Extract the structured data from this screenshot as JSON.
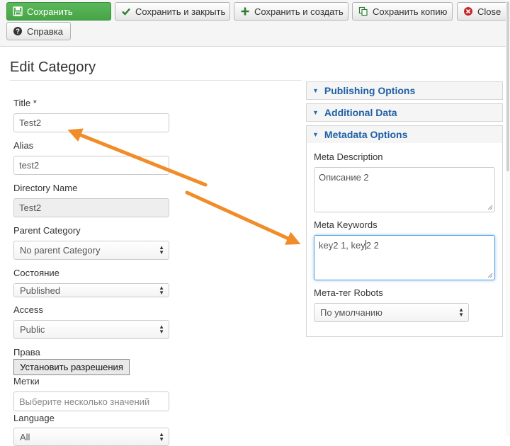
{
  "toolbar": {
    "save": "Сохранить",
    "save_close": "Сохранить и закрыть",
    "save_new": "Сохранить и создать",
    "save_copy": "Сохранить копию",
    "close": "Close",
    "help": "Справка"
  },
  "page_title": "Edit Category",
  "form": {
    "title_label": "Title *",
    "title_value": "Test2",
    "alias_label": "Alias",
    "alias_value": "test2",
    "dir_label": "Directory Name",
    "dir_value": "Test2",
    "parent_label": "Parent Category",
    "parent_value": "No parent Category",
    "state_label": "Состояние",
    "state_value": "Published",
    "access_label": "Access",
    "access_value": "Public",
    "rights_label": "Права",
    "rights_button": "Установить разрешения",
    "tags_label": "Метки",
    "tags_placeholder": "Выберите несколько значений",
    "language_label": "Language",
    "language_value": "All"
  },
  "accordion": {
    "publishing": "Publishing Options",
    "additional": "Additional Data",
    "metadata": "Metadata Options"
  },
  "metadata": {
    "desc_label": "Meta Description",
    "desc_value": "Описание 2",
    "keywords_label": "Meta Keywords",
    "keywords_before_cursor": "key2 1, key",
    "keywords_after_cursor": "2 2",
    "robots_label": "Мета-тег Robots",
    "robots_value": "По умолчанию"
  },
  "colors": {
    "accent": "#1f5fa5",
    "success": "#46a546",
    "annotation_arrow": "#f28c28"
  }
}
